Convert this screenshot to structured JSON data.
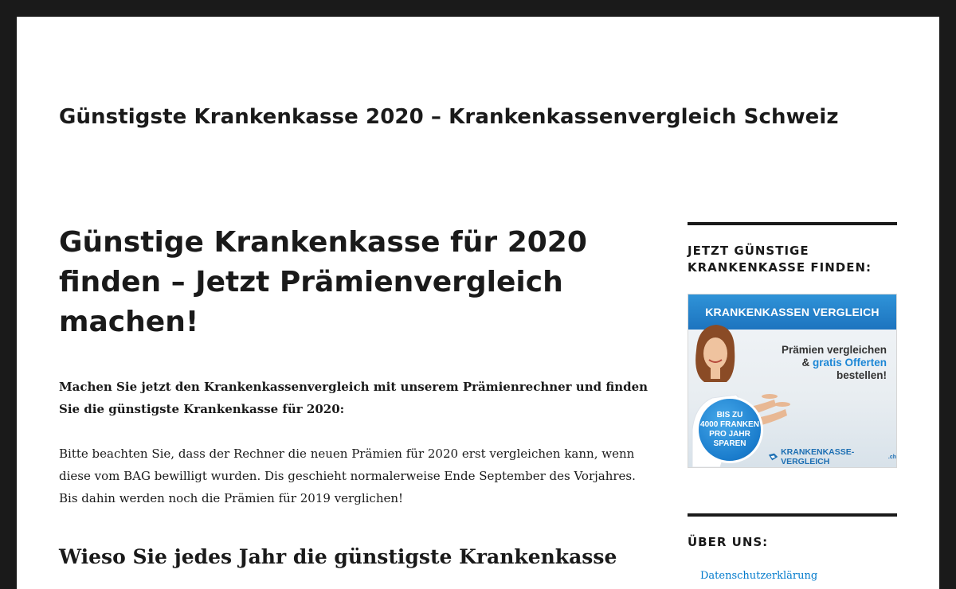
{
  "site": {
    "title": "Günstigste Krankenkasse 2020 – Krankenkassenvergleich Schweiz"
  },
  "article": {
    "title": "Günstige Krankenkasse für 2020 finden – Jetzt Prämienvergleich machen!",
    "intro": "Machen Sie jetzt den Krankenkassenvergleich mit unserem Prämienrechner und finden Sie die günstigste Krankenkasse für 2020:",
    "paragraph": "Bitte beachten Sie, dass der Rechner die neuen Prämien für 2020 erst vergleichen kann, wenn diese vom BAG bewilligt wurden. Dis geschieht normalerweise Ende September des Vorjahres. Bis dahin werden noch die Prämien für 2019 verglichen!",
    "subheading": "Wieso Sie jedes Jahr die günstigste Krankenkasse"
  },
  "sidebar": {
    "widget1_title": "JETZT GÜNSTIGE KRANKENKASSE FINDEN:",
    "ad": {
      "headline": "KRANKENKASSEN VERGLEICH",
      "line1": "Prämien vergleichen",
      "line2_prefix": "& ",
      "line2_highlight": "gratis Offerten",
      "line3": "bestellen!",
      "badge_line1": "BIS ZU",
      "badge_line2": "4000 FRANKEN",
      "badge_line3": "PRO JAHR",
      "badge_line4": "SPAREN",
      "logo_text": "KRANKENKASSE-VERGLEICH",
      "logo_tld": ".ch",
      "accent_color": "#1d87d6"
    },
    "widget2_title": "ÜBER UNS:",
    "links": [
      "Datenschutzerklärung"
    ]
  }
}
